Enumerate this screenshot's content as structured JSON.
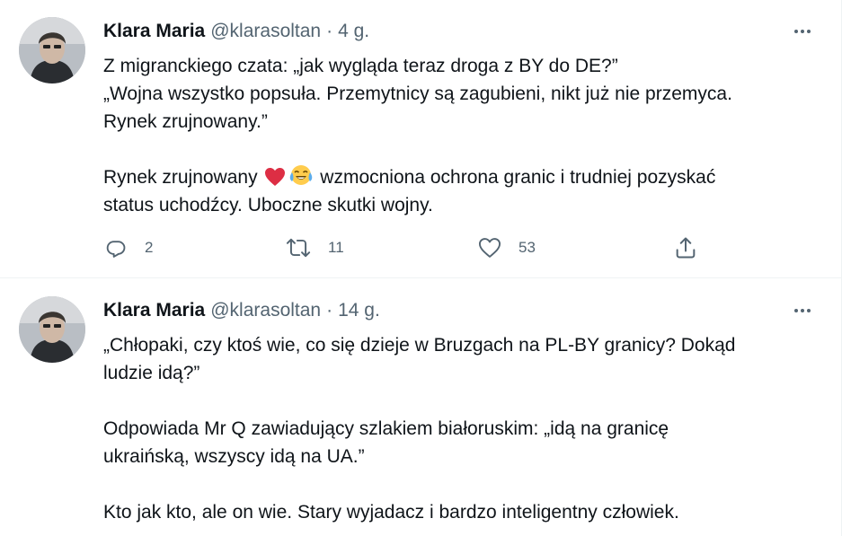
{
  "colors": {
    "text": "#0f1419",
    "secondary": "#536471",
    "divider": "#eff3f4",
    "heart": "#e0245e"
  },
  "tweets": [
    {
      "name": "Klara Maria",
      "handle": "@klarasoltan",
      "separator": "·",
      "time": "4 g.",
      "lines": [
        "Z migranckiego czata: „jak wygląda teraz droga z BY do DE?”",
        "„Wojna wszystko popsuła. Przemytnicy są zagubieni, nikt już nie przemyca.",
        "Rynek zrujnowany.”"
      ],
      "line4_prefix": "Rynek zrujnowany",
      "line4_suffix": "wzmocniona ochrona granic i trudniej pozyskać",
      "line5": "status uchodźcy. Uboczne skutki wojny.",
      "emojis": [
        "red-heart",
        "face-with-tears-of-joy"
      ],
      "stats": {
        "replies": "2",
        "retweets": "11",
        "likes": "53"
      }
    },
    {
      "name": "Klara Maria",
      "handle": "@klarasoltan",
      "separator": "·",
      "time": "14 g.",
      "lines": [
        "„Chłopaki, czy ktoś wie, co się dzieje w Bruzgach na PL-BY granicy? Dokąd",
        "ludzie idą?”",
        "Odpowiada Mr Q zawiadujący szlakiem białoruskim: „idą na granicę",
        "ukraińską, wszyscy idą na UA.”",
        "Kto jak kto, ale on wie. Stary wyjadacz i bardzo inteligentny człowiek."
      ]
    }
  ]
}
